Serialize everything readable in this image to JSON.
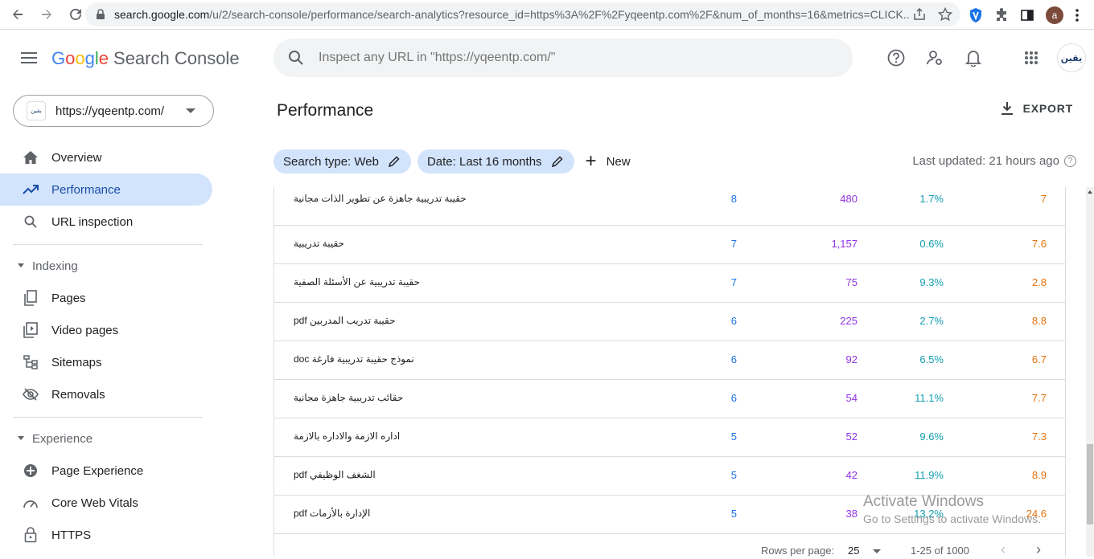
{
  "browser": {
    "url_host": "search.google.com",
    "url_rest": "/u/2/search-console/performance/search-analytics?resource_id=https%3A%2F%2Fyqeentp.com%2F&num_of_months=16&metrics=CLICK...",
    "profile_initial": "a"
  },
  "header": {
    "logo_google": [
      "G",
      "o",
      "o",
      "g",
      "l",
      "e"
    ],
    "logo_product": "Search Console",
    "search_placeholder": "Inspect any URL in \"https://yqeentp.com/\"",
    "profile_text": "يقين"
  },
  "sidebar": {
    "property": "https://yqeentp.com/",
    "property_fav": "يقين",
    "items": [
      {
        "label": "Overview"
      },
      {
        "label": "Performance"
      },
      {
        "label": "URL inspection"
      }
    ],
    "indexing_header": "Indexing",
    "indexing_items": [
      {
        "label": "Pages"
      },
      {
        "label": "Video pages"
      },
      {
        "label": "Sitemaps"
      },
      {
        "label": "Removals"
      }
    ],
    "experience_header": "Experience",
    "experience_items": [
      {
        "label": "Page Experience"
      },
      {
        "label": "Core Web Vitals"
      },
      {
        "label": "HTTPS"
      }
    ]
  },
  "main": {
    "title": "Performance",
    "export_label": "EXPORT",
    "filters": {
      "search_type": "Search type: Web",
      "date": "Date: Last 16 months",
      "new_label": "New"
    },
    "last_updated": "Last updated: 21 hours ago",
    "rows": [
      {
        "query": "حقيبة تدريبية جاهزة عن تطوير الذات مجانية",
        "clicks": "8",
        "impressions": "480",
        "ctr": "1.7%",
        "position": "7"
      },
      {
        "query": "حقيبة تدريبية",
        "clicks": "7",
        "impressions": "1,157",
        "ctr": "0.6%",
        "position": "7.6"
      },
      {
        "query": "حقيبة تدريبية عن الأسئلة الصفية",
        "clicks": "7",
        "impressions": "75",
        "ctr": "9.3%",
        "position": "2.8"
      },
      {
        "query": "حقيبة تدريب المدربين pdf",
        "clicks": "6",
        "impressions": "225",
        "ctr": "2.7%",
        "position": "8.8"
      },
      {
        "query": "نموذج حقيبة تدريبية فارغة doc",
        "clicks": "6",
        "impressions": "92",
        "ctr": "6.5%",
        "position": "6.7"
      },
      {
        "query": "حقائب تدريبية جاهزة مجانية",
        "clicks": "6",
        "impressions": "54",
        "ctr": "11.1%",
        "position": "7.7"
      },
      {
        "query": "اداره الازمة والاداره بالازمة",
        "clicks": "5",
        "impressions": "52",
        "ctr": "9.6%",
        "position": "7.3"
      },
      {
        "query": "الشغف الوظيفي pdf",
        "clicks": "5",
        "impressions": "42",
        "ctr": "11.9%",
        "position": "8.9"
      },
      {
        "query": "الإدارة بالأزمات pdf",
        "clicks": "5",
        "impressions": "38",
        "ctr": "13.2%",
        "position": "24.6"
      }
    ],
    "pager": {
      "rows_per_page_label": "Rows per page:",
      "rows_per_page": "25",
      "range": "1-25 of 1000"
    }
  },
  "watermark": {
    "line1": "Activate Windows",
    "line2": "Go to Settings to activate Windows."
  }
}
